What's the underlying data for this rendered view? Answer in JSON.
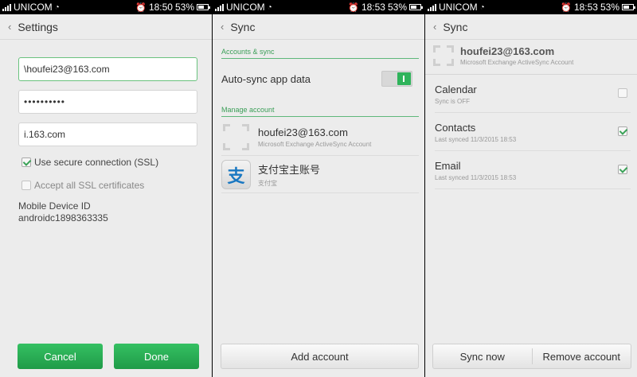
{
  "status_bars": [
    {
      "carrier": "UNICOM",
      "time": "18:50",
      "battery": "53%"
    },
    {
      "carrier": "UNICOM",
      "time": "18:53",
      "battery": "53%"
    },
    {
      "carrier": "UNICOM",
      "time": "18:53",
      "battery": "53%"
    }
  ],
  "settings": {
    "title": "Settings",
    "username": "\\houfei23@163.com",
    "password": "••••••••••",
    "server": "i.163.com",
    "ssl_label": "Use secure connection (SSL)",
    "ssl_checked": true,
    "accept_certs_label": "Accept all SSL certificates",
    "accept_certs_checked": false,
    "device_id_label": "Mobile Device ID",
    "device_id": "androidc1898363335",
    "cancel": "Cancel",
    "done": "Done"
  },
  "sync": {
    "title": "Sync",
    "accounts_header": "Accounts & sync",
    "autosync_label": "Auto-sync app data",
    "autosync_on": true,
    "manage_header": "Manage account",
    "accounts": [
      {
        "name": "houfei23@163.com",
        "type": "Microsoft Exchange ActiveSync Account",
        "icon": "exchange-placeholder-icon"
      },
      {
        "name": "支付宝主账号",
        "type": "支付宝",
        "icon": "alipay-icon"
      }
    ],
    "add_account": "Add account"
  },
  "account_sync": {
    "title": "Sync",
    "account_name": "houfei23@163.com",
    "account_type": "Microsoft Exchange ActiveSync Account",
    "items": [
      {
        "name": "Calendar",
        "status": "Sync is OFF",
        "checked": false
      },
      {
        "name": "Contacts",
        "status": "Last synced 11/3/2015 18:53",
        "checked": true
      },
      {
        "name": "Email",
        "status": "Last synced 11/3/2015 18:53",
        "checked": true
      }
    ],
    "sync_now": "Sync now",
    "remove_account": "Remove account"
  },
  "icons": {
    "back": "‹",
    "alipay_glyph": "支"
  },
  "colors": {
    "accent_green": "#2fb35b",
    "section_green": "#3a9e57"
  }
}
